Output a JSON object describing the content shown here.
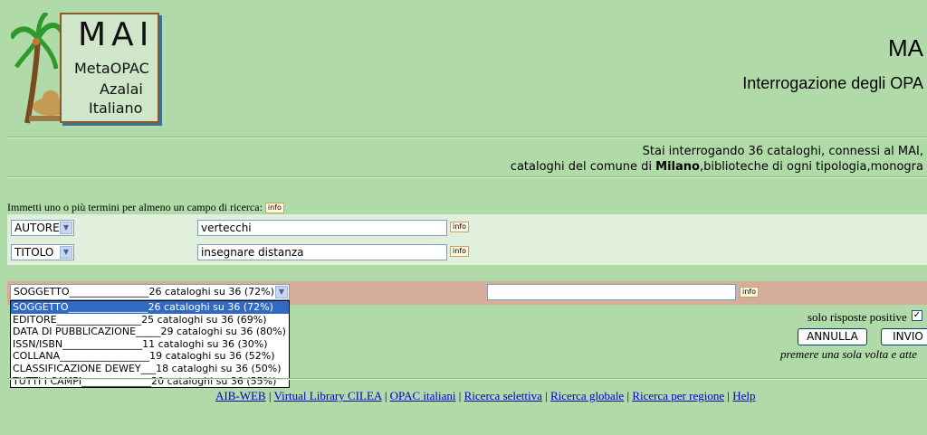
{
  "logo": {
    "title": "MAI",
    "lines": [
      "MetaOPAC",
      "Azalai",
      "Italiano"
    ],
    "icon": "palm-camel-logo"
  },
  "header": {
    "title": "MA",
    "subtitle": "Interrogazione degli OPA"
  },
  "info": {
    "line1": "Stai interrogando 36 cataloghi, connessi al MAI,",
    "line2_pre": "cataloghi del comune di ",
    "line2_bold": "Milano",
    "line2_post": ",biblioteche di ogni tipologia,monogra"
  },
  "search": {
    "prompt": "Immetti uno o più termini per almeno un campo di ricerca:",
    "info_label": "info",
    "rows": [
      {
        "field": "AUTORE",
        "value": "vertecchi"
      },
      {
        "field": "TITOLO",
        "value": "insegnare distanza"
      }
    ],
    "third": {
      "field": "SOGGETTO________________26 cataloghi su 36 (72%)",
      "value": ""
    }
  },
  "dropdown": {
    "options": [
      "SOGGETTO________________26 cataloghi su 36 (72%)",
      "EDITORE_________________25 cataloghi su 36 (69%)",
      "DATA DI PUBBLICAZIONE_____29 cataloghi su 36 (80%)",
      "ISSN/ISBN________________11 cataloghi su 36 (30%)",
      "COLLANA__________________19 cataloghi su 36 (52%)",
      "CLASSIFICAZIONE DEWEY___18 cataloghi su 36 (50%)",
      "TUTTI I CAMPI______________20 cataloghi su 36 (55%)"
    ],
    "selected_index": 0
  },
  "options": {
    "solo_label": "solo risposte positive",
    "solo_checked": "✓"
  },
  "buttons": {
    "annulla": "ANNULLA",
    "invio": "INVIO"
  },
  "note": "premere una sola volta e atte",
  "footer": {
    "links": [
      "AIB-WEB",
      "Virtual Library CILEA",
      "OPAC italiani",
      "Ricerca selettiva",
      "Ricerca globale",
      "Ricerca per regione",
      "Help"
    ],
    "separator": "|"
  }
}
